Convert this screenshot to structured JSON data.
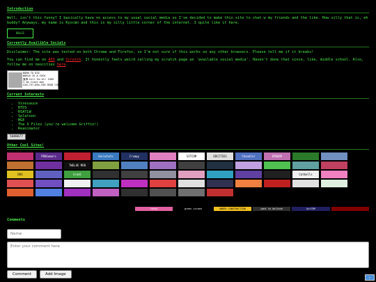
{
  "intro": {
    "heading": "Introduction",
    "text": "Well, isn't this funny? I basically have no access to my usual social media so I've decided to make this site to chat w my friends and the like. How silly that is, eh buddy? Anyways, my name is Kyscmn and this is my silly little corner of the internet. I quite like it here.",
    "badge": "88x31"
  },
  "socials": {
    "heading": "Currently Availible Socials",
    "disclaimer": "Disclaimer: The site was tested on both Chrome and Firefox, so I'm not sure if this works on any other browsers. Please tell me if it breaks!",
    "find_prefix": "You can find me on ",
    "link1": "AO3",
    "and": " and ",
    "link2": "Scratch",
    "find_suffix": ". It honestly feels weird calling my scratch page an 'available social media'. Haven't done that since, like, middle school. Also, follow me on neocities ",
    "link3": "here",
    "end": ".",
    "blinkie_text": "BORN TO DIE\nWORLD IS A FUCK\n鬼神 Kill Em All 1989\nI am trash man\n410,757,864,530 DEAD COPS"
  },
  "interests": {
    "heading": "Current Interests",
    "items": [
      "Vinesauce",
      "BTDS",
      "RSATLW",
      "Splatoon",
      "MGE",
      "The X Files (you're welcome Griffin!)",
      "Reanimator"
    ],
    "counter": "5688677"
  },
  "sites": {
    "heading": "Other Cool Sites!",
    "buttons": [
      {
        "label": "",
        "color": "#c03070"
      },
      {
        "label": "PROGamers",
        "color": "#5a2a8a"
      },
      {
        "label": "",
        "color": "#c02030"
      },
      {
        "label": "Aeroshots",
        "color": "#3a7ac0"
      },
      {
        "label": "Crumpy",
        "color": "#203060"
      },
      {
        "label": "",
        "color": "#e080c0"
      },
      {
        "label": "SITCOM",
        "color": "#ffffff"
      },
      {
        "label": "EDCITIES",
        "color": "#e0e0e0"
      },
      {
        "label": "Chandler",
        "color": "#5070c0"
      },
      {
        "label": "EMSHOP",
        "color": "#c070b0"
      },
      {
        "label": "",
        "color": "#2a7a2a"
      },
      {
        "label": "",
        "color": "#7090c0"
      },
      {
        "label": "",
        "color": "#c07030"
      },
      {
        "label": "",
        "color": "#7030a0"
      },
      {
        "label": "TWELVE MEN",
        "color": "#101010"
      },
      {
        "label": "",
        "color": "#80a040"
      },
      {
        "label": "",
        "color": "#5080c0"
      },
      {
        "label": "",
        "color": "#a070c0"
      },
      {
        "label": "",
        "color": "#404040"
      },
      {
        "label": "",
        "color": "#203040"
      },
      {
        "label": "",
        "color": "#c0a0e0"
      },
      {
        "label": "",
        "color": "#50c050"
      },
      {
        "label": "",
        "color": "#60a0a0"
      },
      {
        "label": "",
        "color": "#c04060"
      },
      {
        "label": "DOS",
        "color": "#e0c020"
      },
      {
        "label": "",
        "color": "#6060c0"
      },
      {
        "label": "Gradi",
        "color": "#40a040"
      },
      {
        "label": "",
        "color": "#303030"
      },
      {
        "label": "",
        "color": "#404040"
      },
      {
        "label": "",
        "color": "#9090a0"
      },
      {
        "label": "",
        "color": "#e0a0c0"
      },
      {
        "label": "",
        "color": "#30a0c0"
      },
      {
        "label": "",
        "color": "#6040a0"
      },
      {
        "label": "",
        "color": "#202020"
      },
      {
        "label": "Catbells",
        "color": "#f0f0f0"
      },
      {
        "label": "",
        "color": "#f080c0"
      },
      {
        "label": "",
        "color": "#e05050"
      },
      {
        "label": "",
        "color": "#7050c0"
      },
      {
        "label": "",
        "color": "#f0f0f0"
      },
      {
        "label": "",
        "color": "#40a0c0"
      },
      {
        "label": "",
        "color": "#c030c0"
      },
      {
        "label": "",
        "color": "#e04040"
      },
      {
        "label": "",
        "color": "#e0e0e0"
      },
      {
        "label": "",
        "color": "#303050"
      },
      {
        "label": "",
        "color": "#f08040"
      },
      {
        "label": "",
        "color": "#c02020"
      },
      {
        "label": "",
        "color": "#e0e0e0"
      },
      {
        "label": "",
        "color": "#e0f0e0"
      },
      {
        "label": "",
        "color": "#e06030"
      },
      {
        "label": "",
        "color": "#5080e0"
      },
      {
        "label": "",
        "color": "#a030c0"
      },
      {
        "label": "",
        "color": "#c060c0"
      },
      {
        "label": "",
        "color": "#303030"
      },
      {
        "label": "",
        "color": "#505050"
      },
      {
        "label": "",
        "color": "#707070"
      },
      {
        "label": "",
        "color": "#c03030"
      },
      {
        "label": "",
        "color": "#000000"
      },
      {
        "label": "",
        "color": "#000000"
      },
      {
        "label": "",
        "color": "#000000"
      },
      {
        "label": "",
        "color": "#000000"
      }
    ],
    "strip": [
      {
        "label": "token",
        "color": "#e060a0"
      },
      {
        "label": "green screen",
        "color": "#000000"
      },
      {
        "label": "UNDER CONSTRUCTION",
        "color": "#f0c020"
      },
      {
        "label": "want to believe",
        "color": "#303030"
      },
      {
        "label": "Ast7EM",
        "color": "#202060"
      },
      {
        "label": "",
        "color": "#800000"
      }
    ]
  },
  "comments": {
    "heading": "Comments",
    "name_placeholder": "Name",
    "comment_placeholder": "Enter your comment here",
    "comment_button": "Comment",
    "image_button": "Add Image"
  }
}
